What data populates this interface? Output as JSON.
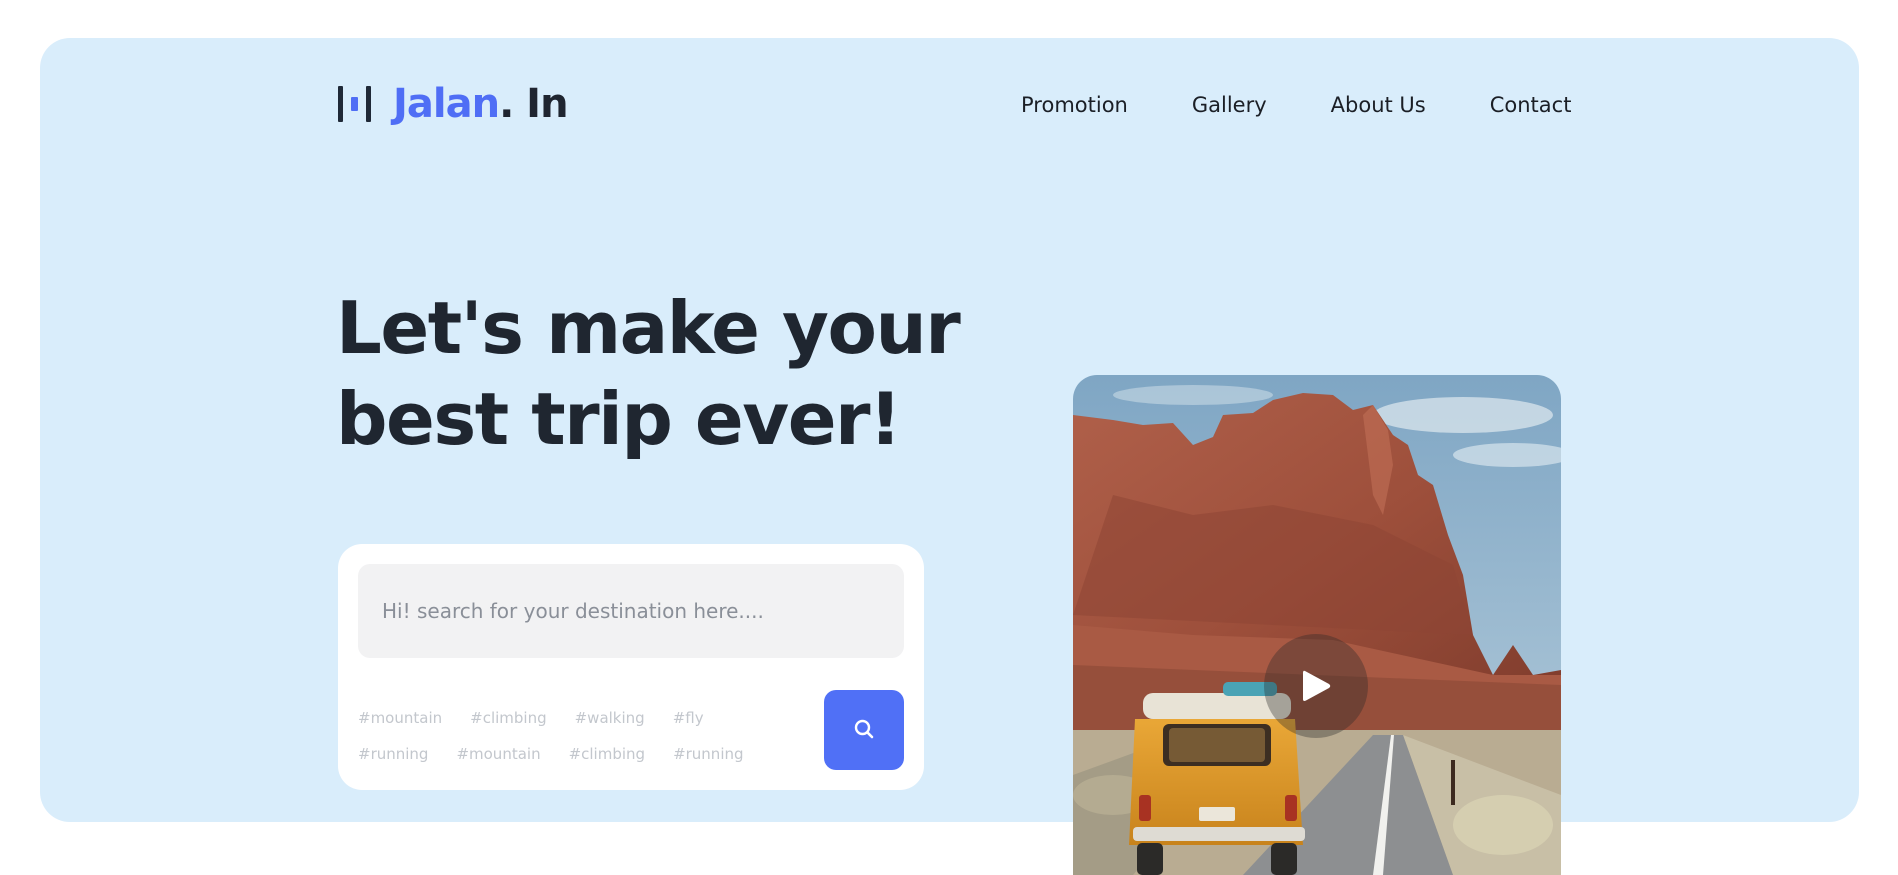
{
  "header": {
    "logo_brand": "Jalan",
    "logo_suffix": ". In",
    "nav": [
      {
        "label": "Promotion"
      },
      {
        "label": "Gallery"
      },
      {
        "label": "About Us"
      },
      {
        "label": "Contact"
      }
    ]
  },
  "hero": {
    "headline_line1": "Let's make your",
    "headline_line2": "best trip ever!"
  },
  "search": {
    "placeholder": "Hi! search for your destination here....",
    "tags_row1": [
      "#mountain",
      "#climbing",
      "#walking",
      "#fly"
    ],
    "tags_row2": [
      "#running",
      "#mountain",
      "#climbing",
      "#running"
    ]
  },
  "icons": {
    "search": "search-icon",
    "play": "play-icon",
    "logo": "logo-mark-icon"
  },
  "colors": {
    "hero_background": "#d9edfb",
    "accent": "#5070f6",
    "text_dark": "#1f2630",
    "tag_text": "#c3c7cd"
  }
}
